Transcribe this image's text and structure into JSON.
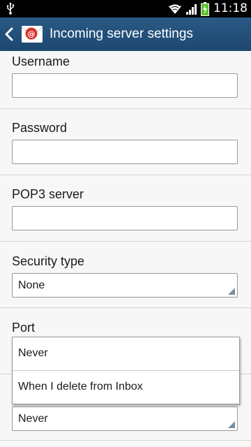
{
  "status_bar": {
    "time": "11:18",
    "icons": [
      "usb-icon",
      "wifi-icon",
      "signal-icon",
      "battery-charging-icon"
    ]
  },
  "action_bar": {
    "title": "Incoming server settings",
    "back_icon": "chevron-left-icon",
    "app_icon": "email-app-icon"
  },
  "form": {
    "username": {
      "label": "Username",
      "value": ""
    },
    "password": {
      "label": "Password",
      "value": ""
    },
    "pop3_server": {
      "label": "POP3 server",
      "value": ""
    },
    "security_type": {
      "label": "Security type",
      "value": "None"
    },
    "port": {
      "label": "Port"
    },
    "delete_policy": {
      "value": "Never"
    }
  },
  "dropdown": {
    "options": [
      "Never",
      "When I delete from Inbox"
    ]
  },
  "colors": {
    "action_bar": "#1f4e79",
    "status_bar": "#000000",
    "background": "#f7f7f7",
    "app_icon_red": "#d9322b"
  }
}
